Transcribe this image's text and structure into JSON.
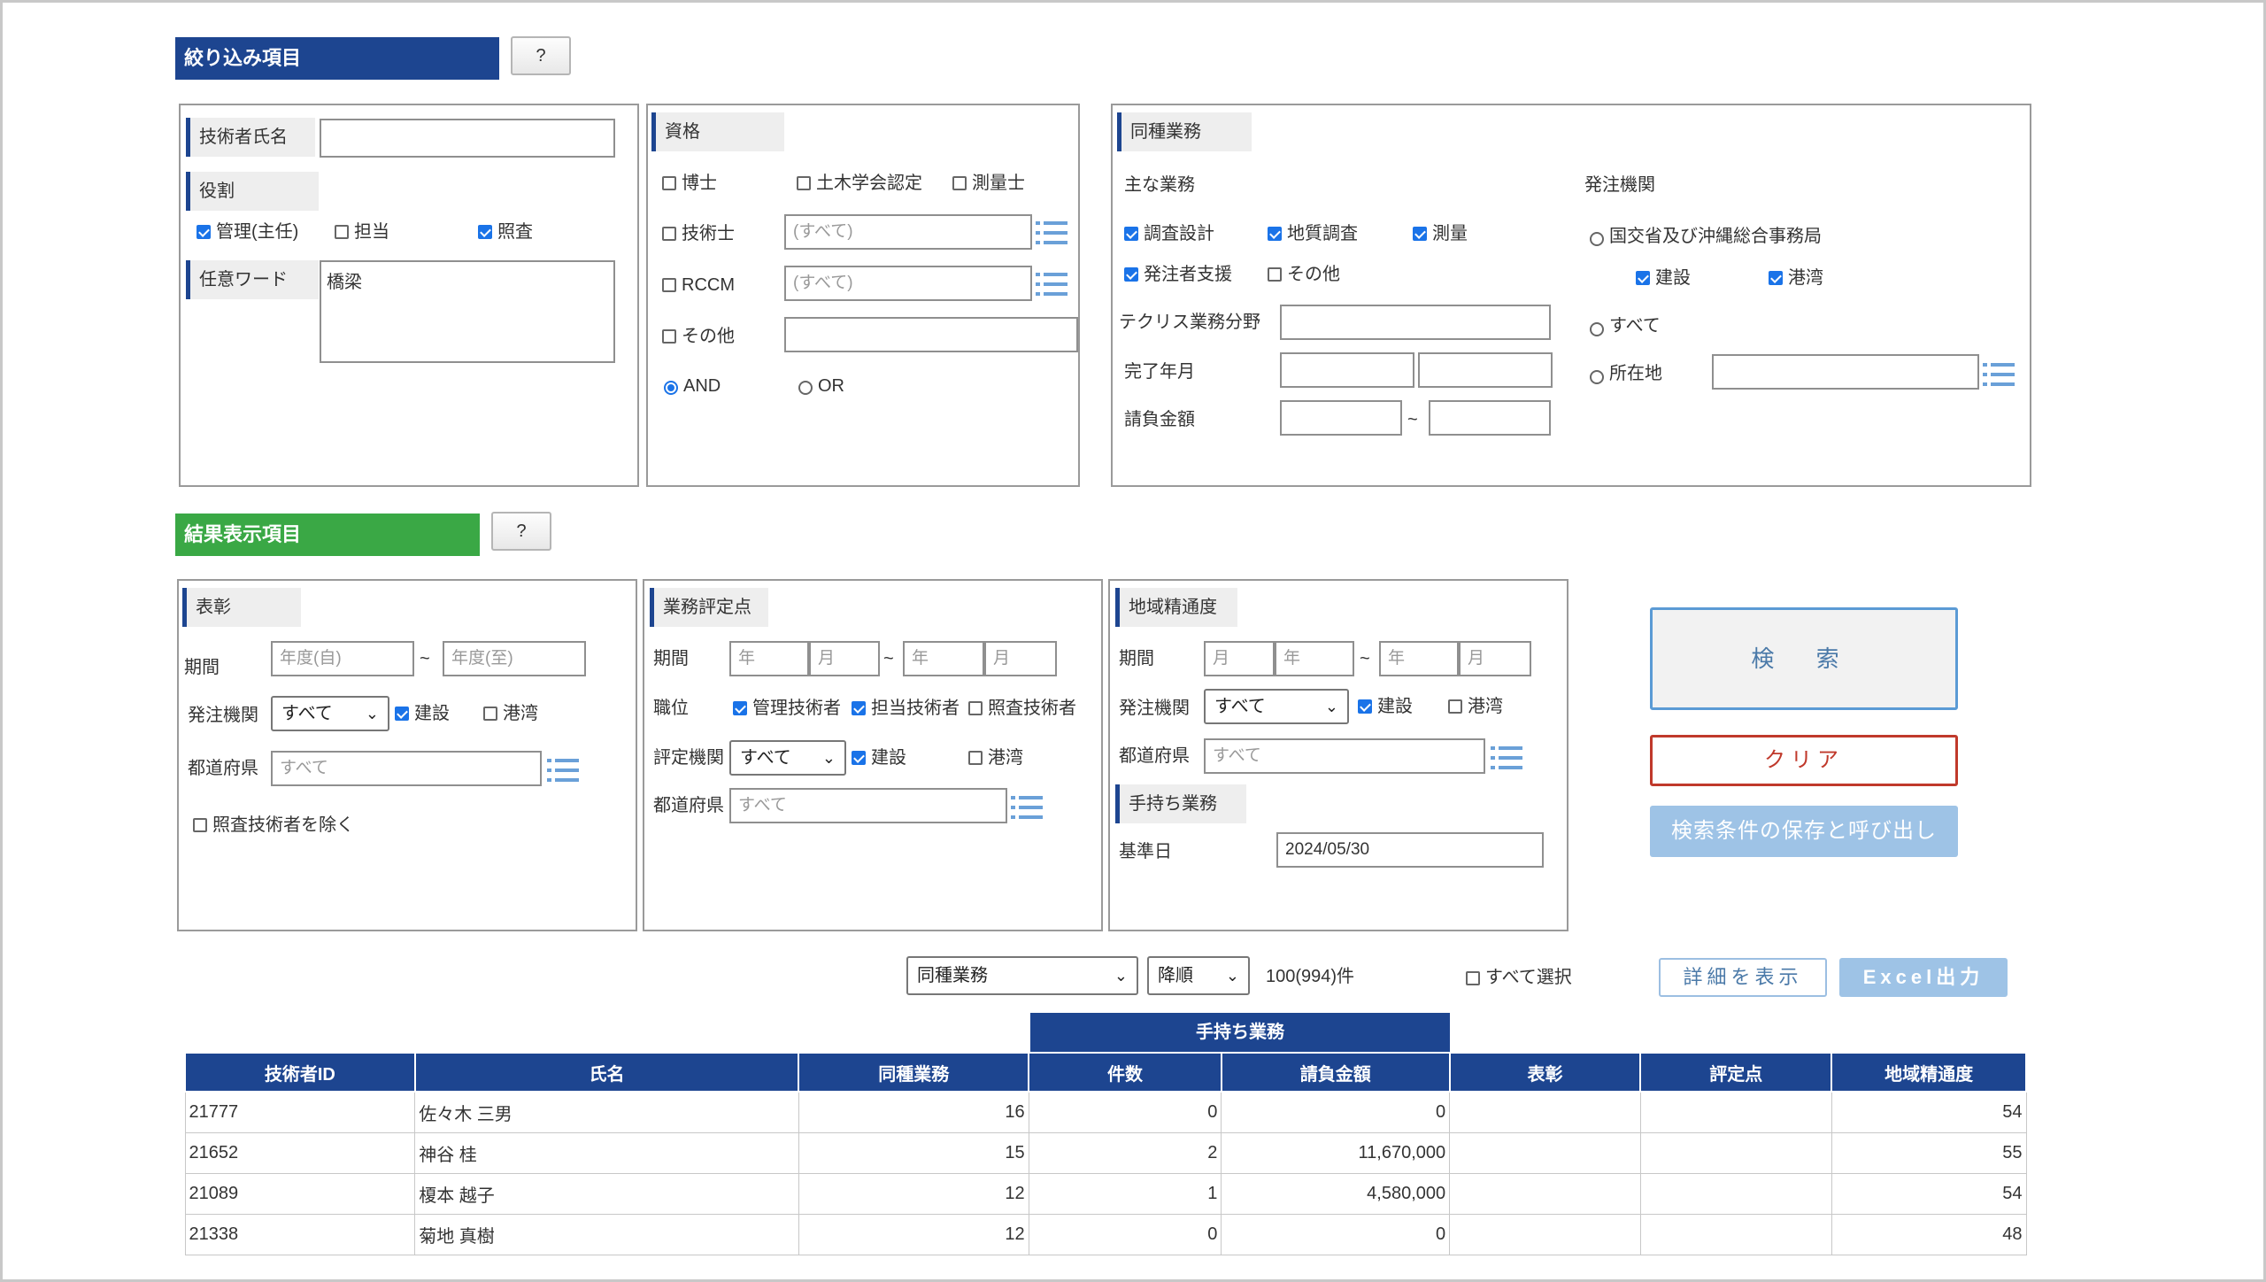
{
  "filter_section": {
    "title": "絞り込み項目",
    "help": "?"
  },
  "result_section": {
    "title": "結果表示項目",
    "help": "?"
  },
  "engineer": {
    "name_label": "技術者氏名",
    "name_value": "",
    "role_label": "役割",
    "roles": [
      {
        "label": "管理(主任)",
        "checked": true
      },
      {
        "label": "担当",
        "checked": false
      },
      {
        "label": "照査",
        "checked": true
      }
    ],
    "keyword_label": "任意ワード",
    "keyword_value": "橋梁"
  },
  "qualification": {
    "title": "資格",
    "items": [
      {
        "label": "博士",
        "checked": false
      },
      {
        "label": "土木学会認定",
        "checked": false
      },
      {
        "label": "測量士",
        "checked": false
      },
      {
        "label": "技術士",
        "checked": false,
        "placeholder": "(すべて)"
      },
      {
        "label": "RCCM",
        "checked": false,
        "placeholder": "(すべて)"
      },
      {
        "label": "その他",
        "checked": false,
        "placeholder": ""
      }
    ],
    "logic": [
      {
        "label": "AND",
        "selected": true
      },
      {
        "label": "OR",
        "selected": false
      }
    ]
  },
  "similar_work": {
    "title": "同種業務",
    "main_label": "主な業務",
    "works": [
      {
        "label": "調査設計",
        "checked": true
      },
      {
        "label": "地質調査",
        "checked": true
      },
      {
        "label": "測量",
        "checked": true
      },
      {
        "label": "発注者支援",
        "checked": true
      },
      {
        "label": "その他",
        "checked": false
      }
    ],
    "techris_label": "テクリス業務分野",
    "completion_label": "完了年月",
    "amount_label": "請負金額",
    "tilde": "~",
    "orderer_label": "発注機関",
    "orderer_options": [
      {
        "label": "国交省及び沖縄総合事務局",
        "selected": false
      },
      {
        "label": "すべて",
        "selected": false
      },
      {
        "label": "所在地",
        "selected": false
      }
    ],
    "orderer_sub": [
      {
        "label": "建設",
        "checked": true
      },
      {
        "label": "港湾",
        "checked": true
      }
    ]
  },
  "award": {
    "title": "表彰",
    "period_label": "期間",
    "from_placeholder": "年度(自)",
    "to_placeholder": "年度(至)",
    "tilde": "~",
    "orderer_label": "発注機関",
    "orderer_select": "すべて",
    "sub": [
      {
        "label": "建設",
        "checked": true
      },
      {
        "label": "港湾",
        "checked": false
      }
    ],
    "pref_label": "都道府県",
    "pref_placeholder": "すべて",
    "exclude_label": "照査技術者を除く",
    "exclude_checked": false
  },
  "evaluation": {
    "title": "業務評定点",
    "period_label": "期間",
    "year_ph": "年",
    "month_ph": "月",
    "tilde": "~",
    "position_label": "職位",
    "positions": [
      {
        "label": "管理技術者",
        "checked": true
      },
      {
        "label": "担当技術者",
        "checked": true
      },
      {
        "label": "照査技術者",
        "checked": false
      }
    ],
    "orderer_label": "評定機関",
    "orderer_select": "すべて",
    "sub": [
      {
        "label": "建設",
        "checked": true
      },
      {
        "label": "港湾",
        "checked": false
      }
    ],
    "pref_label": "都道府県",
    "pref_placeholder": "すべて"
  },
  "regional": {
    "title": "地域精通度",
    "period_label": "期間",
    "year_ph": "年",
    "month_ph": "月",
    "tilde": "~",
    "orderer_label": "発注機関",
    "orderer_select": "すべて",
    "sub": [
      {
        "label": "建設",
        "checked": true
      },
      {
        "label": "港湾",
        "checked": false
      }
    ],
    "pref_label": "都道府県",
    "pref_placeholder": "すべて",
    "inhand_title": "手持ち業務",
    "base_date_label": "基準日",
    "base_date_value": "2024/05/30"
  },
  "actions": {
    "search": "検 索",
    "clear": "クリア",
    "save_load": "検索条件の保存と呼び出し"
  },
  "toolbar": {
    "sort_field": "同種業務",
    "sort_order": "降順",
    "count": "100(994)件",
    "select_all": "すべて選択",
    "detail": "詳細を表示",
    "excel": "Excel出力"
  },
  "table": {
    "group_header": "手持ち業務",
    "columns": [
      "技術者ID",
      "氏名",
      "同種業務",
      "件数",
      "請負金額",
      "表彰",
      "評定点",
      "地域精通度"
    ],
    "rows": [
      [
        "21777",
        "佐々木 三男",
        "16",
        "0",
        "0",
        "",
        "",
        "54"
      ],
      [
        "21652",
        "神谷 桂",
        "15",
        "2",
        "11,670,000",
        "",
        "",
        "55"
      ],
      [
        "21089",
        "榎本 越子",
        "12",
        "1",
        "4,580,000",
        "",
        "",
        "54"
      ],
      [
        "21338",
        "菊地 真樹",
        "12",
        "0",
        "0",
        "",
        "",
        "48"
      ]
    ]
  },
  "colors": {
    "navy": "#1d4590",
    "green": "#3aa845",
    "clear_red": "#c0392b",
    "light_blue_btn": "#9ec3e6",
    "checkbox_blue": "#1a73e8"
  }
}
